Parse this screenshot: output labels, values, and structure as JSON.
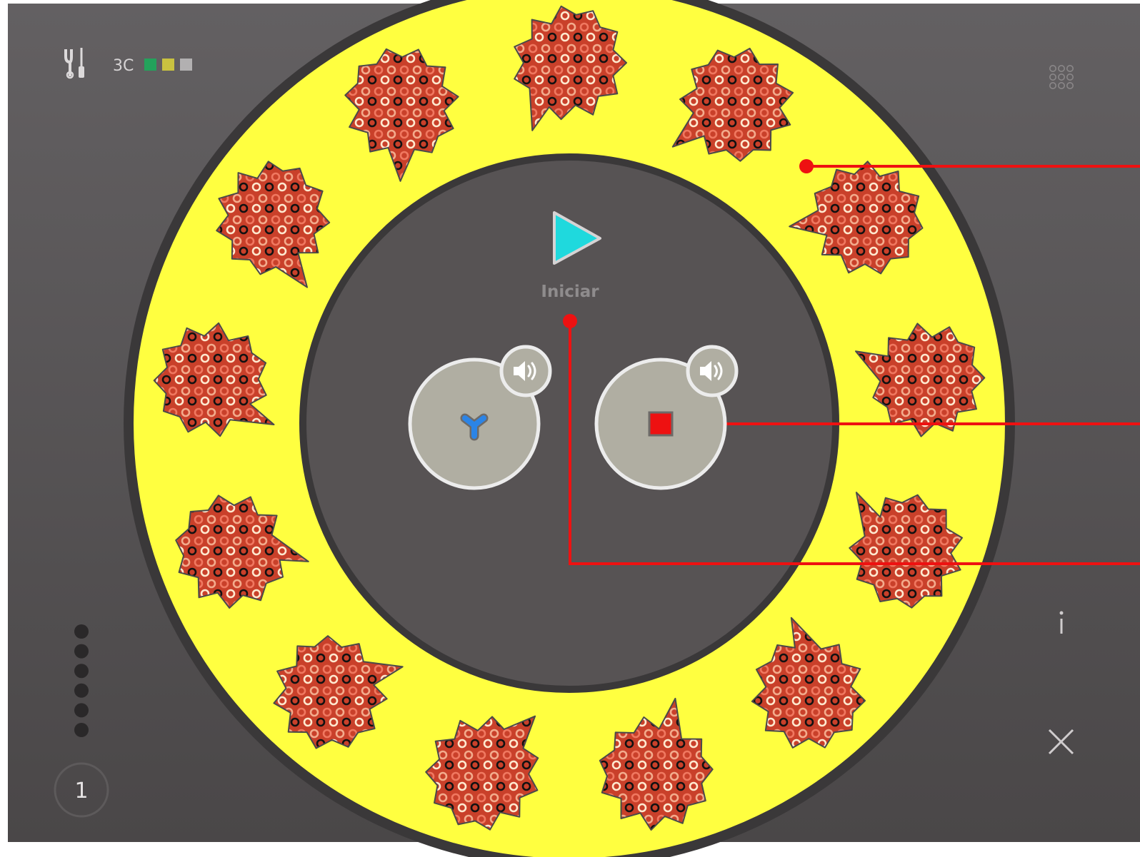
{
  "header": {
    "code": "3C",
    "code_colors": [
      "#23a25b",
      "#c9c240",
      "#b2b0b1"
    ]
  },
  "icons": {
    "tools": "tools-icon",
    "grid_menu": "grid-menu-icon",
    "info": "info-icon",
    "close": "close-icon",
    "play": "play-icon",
    "speaker": "speaker-icon",
    "y_shape": "y-shape-icon",
    "square": "square-icon"
  },
  "start": {
    "label": "Iniciar"
  },
  "level": {
    "number": "1",
    "dot_count": 6
  },
  "ring": {
    "splat_count": 13
  },
  "colors": {
    "ring_yellow": "#ffff40",
    "splat_fill": "#c9402a",
    "play": "#1fd9dd",
    "y_shape": "#2b84e6",
    "square": "#ee1111",
    "connector": "#ee1111",
    "sound_disc": "#b0aea2"
  }
}
